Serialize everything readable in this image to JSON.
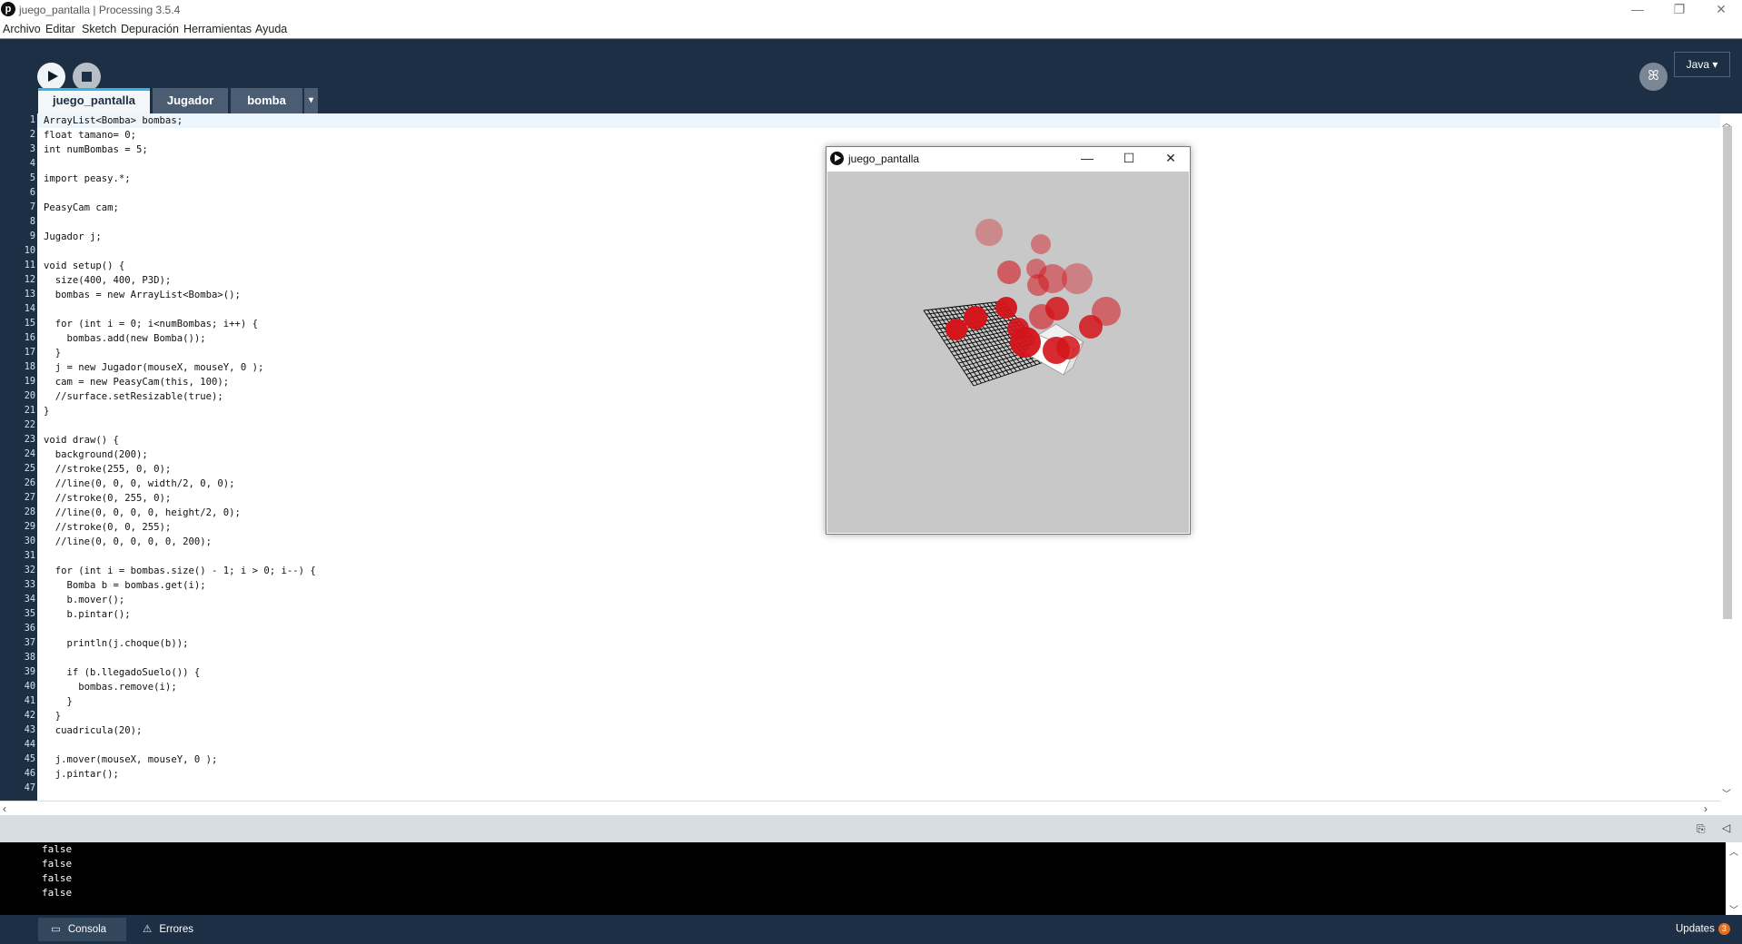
{
  "window": {
    "title": "juego_pantalla | Processing 3.5.4",
    "controls": {
      "minimize": "—",
      "maximize": "❐",
      "close": "✕"
    }
  },
  "menu": [
    "Archivo",
    "Editar",
    "Sketch",
    "Depuración",
    "Herramientas",
    "Ayuda"
  ],
  "toolbar": {
    "run_icon": "play-icon",
    "stop_icon": "stop-icon",
    "debug_icon": "butterfly-icon",
    "mode": "Java ▾"
  },
  "tabs": [
    "juego_pantalla",
    "Jugador",
    "bomba"
  ],
  "tab_menu_icon": "▾",
  "code": [
    "ArrayList<Bomba> bombas;",
    "float tamano= 0;",
    "int numBombas = 5;",
    "",
    "import peasy.*;",
    "",
    "PeasyCam cam;",
    "",
    "Jugador j;",
    "",
    "void setup() {",
    "  size(400, 400, P3D);",
    "  bombas = new ArrayList<Bomba>();",
    "",
    "  for (int i = 0; i<numBombas; i++) {",
    "    bombas.add(new Bomba());",
    "  }",
    "  j = new Jugador(mouseX, mouseY, 0 );",
    "  cam = new PeasyCam(this, 100);",
    "  //surface.setResizable(true);",
    "}",
    "",
    "void draw() {",
    "  background(200);",
    "  //stroke(255, 0, 0);",
    "  //line(0, 0, 0, width/2, 0, 0);",
    "  //stroke(0, 255, 0);",
    "  //line(0, 0, 0, 0, height/2, 0);",
    "  //stroke(0, 0, 255);",
    "  //line(0, 0, 0, 0, 0, 200);",
    "",
    "  for (int i = bombas.size() - 1; i > 0; i--) {",
    "    Bomba b = bombas.get(i);",
    "    b.mover();",
    "    b.pintar();",
    "",
    "    println(j.choque(b));",
    "",
    "    if (b.llegadoSuelo()) {",
    "      bombas.remove(i);",
    "    }",
    "  }",
    "  cuadricula(20);",
    "",
    "  j.mover(mouseX, mouseY, 0 );",
    "  j.pintar();",
    ""
  ],
  "sketch_window": {
    "title": "juego_pantalla",
    "controls": {
      "minimize": "—",
      "maximize": "☐",
      "close": "✕"
    },
    "background": "#c8c8c8"
  },
  "console": {
    "lines": [
      "false",
      "false",
      "false",
      "false"
    ]
  },
  "statusbar": {
    "console_tab": "Consola",
    "errors_tab": "Errores",
    "updates_label": "Updates",
    "updates_count": "3"
  },
  "colors": {
    "toolbar_bg": "#1c2f44",
    "tab_accent": "#32b3e3",
    "bomb_red": "#d4141b"
  }
}
